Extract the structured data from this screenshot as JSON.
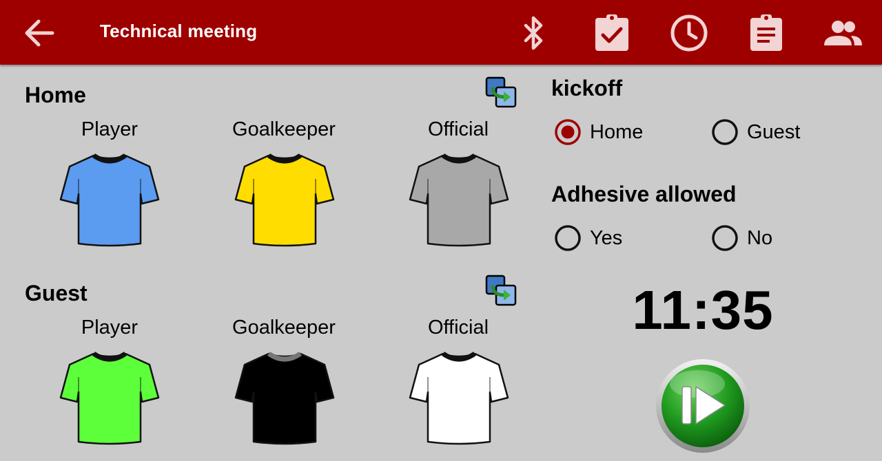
{
  "header": {
    "title": "Technical meeting"
  },
  "icons": {
    "back": "arrow-left-icon",
    "actions": [
      "bluetooth-icon",
      "clipboard-check-icon",
      "clock-icon",
      "clipboard-list-icon",
      "people-icon"
    ]
  },
  "home": {
    "title": "Home",
    "columns": [
      "Player",
      "Goalkeeper",
      "Official"
    ],
    "shirt_colors": [
      "#5b9bf0",
      "#ffdd00",
      "#a8a8a8"
    ]
  },
  "guest": {
    "title": "Guest",
    "columns": [
      "Player",
      "Goalkeeper",
      "Official"
    ],
    "shirt_colors": [
      "#5cff3a",
      "#000000",
      "#ffffff"
    ]
  },
  "kickoff": {
    "title": "kickoff",
    "options": [
      "Home",
      "Guest"
    ],
    "selected": "Home"
  },
  "adhesive": {
    "title": "Adhesive allowed",
    "options": [
      "Yes",
      "No"
    ],
    "selected": null
  },
  "timer": "11:35",
  "colors": {
    "appbar": "#9e0000",
    "background": "#cbcbcb",
    "radio_selected": "#9e0000",
    "play_button": "#1f8c1f"
  }
}
